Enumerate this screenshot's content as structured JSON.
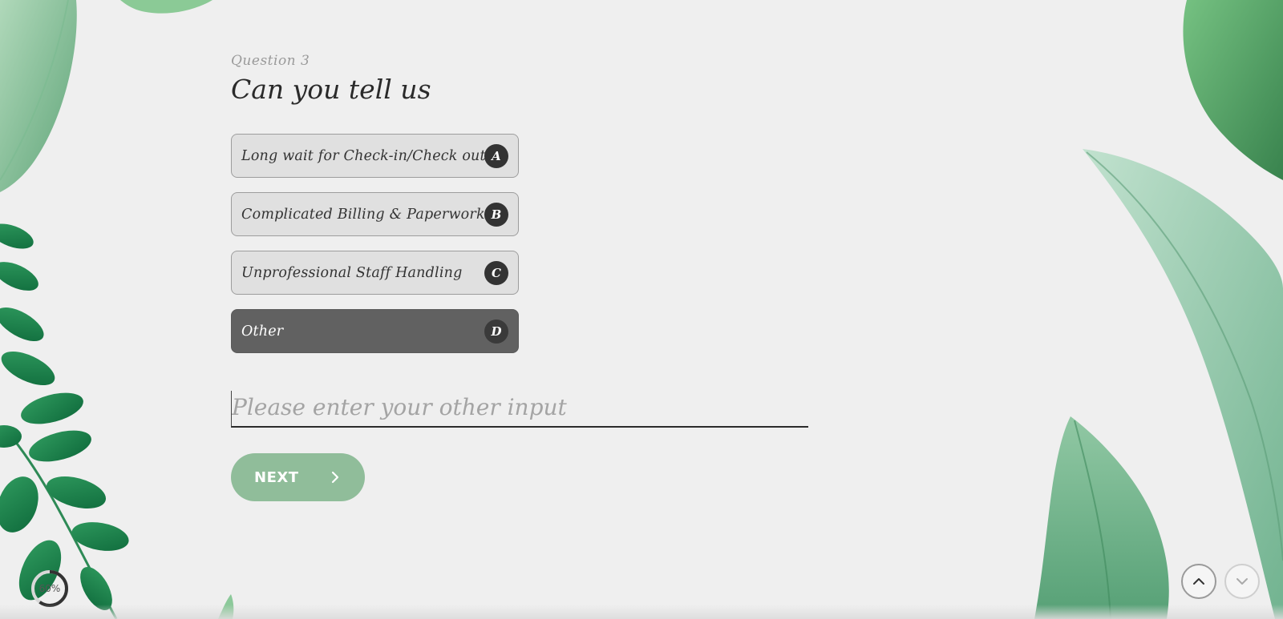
{
  "question": {
    "number_label": "Question 3",
    "title": "Can you tell us"
  },
  "options": [
    {
      "label": "Long wait for Check-in/Check out",
      "key": "A",
      "selected": false
    },
    {
      "label": "Complicated Billing & Paperwork",
      "key": "B",
      "selected": false
    },
    {
      "label": "Unprofessional Staff Handling",
      "key": "C",
      "selected": false
    },
    {
      "label": "Other",
      "key": "D",
      "selected": true
    }
  ],
  "other_input": {
    "value": "",
    "placeholder": "Please enter your other input"
  },
  "next_button": {
    "label": "NEXT"
  },
  "progress": {
    "label": "60%",
    "value": 0.6
  },
  "colors": {
    "background": "#efefef",
    "selected_option": "#616161",
    "next_button": "#90bd9a",
    "key_badge": "#333333"
  },
  "icons": {
    "next": "chevron-right-icon",
    "scroll_up": "chevron-up-icon",
    "scroll_down": "chevron-down-icon"
  }
}
